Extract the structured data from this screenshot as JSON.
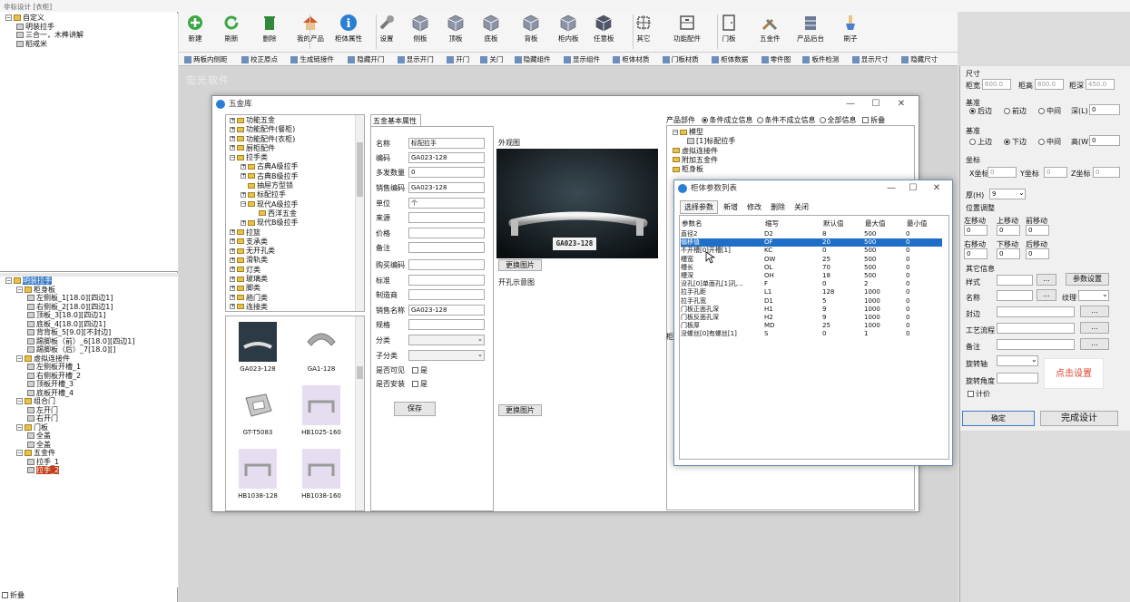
{
  "app_title": "非标设计 [衣柜]",
  "left_tree_top": {
    "nodes": [
      {
        "label": "自定义",
        "level": 0,
        "type": "folder"
      },
      {
        "label": "明装拉手",
        "level": 1,
        "type": "part"
      },
      {
        "label": "三合一，木榫讲解",
        "level": 1,
        "type": "part"
      },
      {
        "label": "稻戒米",
        "level": 1,
        "type": "part"
      }
    ]
  },
  "left_tree_bottom": {
    "nodes": [
      {
        "label": "明装拉手",
        "level": 0,
        "type": "folder",
        "selected": true
      },
      {
        "label": "柜身板",
        "level": 1,
        "type": "folder"
      },
      {
        "label": "左侧板_1[18.0][四边1]",
        "level": 2,
        "type": "part"
      },
      {
        "label": "右侧板_2[18.0][四边1]",
        "level": 2,
        "type": "part"
      },
      {
        "label": "顶板_3[18.0][四边1]",
        "level": 2,
        "type": "part"
      },
      {
        "label": "底板_4[18.0][四边1]",
        "level": 2,
        "type": "part"
      },
      {
        "label": "背背板_5[9.0][不封边]",
        "level": 2,
        "type": "part"
      },
      {
        "label": "踢脚板（前）_6[18.0][四边1]",
        "level": 2,
        "type": "part"
      },
      {
        "label": "踢脚板（后）_7[18.0][]",
        "level": 2,
        "type": "part"
      },
      {
        "label": "虚拟连接件",
        "level": 1,
        "type": "folder"
      },
      {
        "label": "左侧板开槽_1",
        "level": 2,
        "type": "part"
      },
      {
        "label": "右侧板开槽_2",
        "level": 2,
        "type": "part"
      },
      {
        "label": "顶板开槽_3",
        "level": 2,
        "type": "part"
      },
      {
        "label": "底板开槽_4",
        "level": 2,
        "type": "part"
      },
      {
        "label": "组合门",
        "level": 1,
        "type": "folder"
      },
      {
        "label": "左开门",
        "level": 2,
        "type": "part"
      },
      {
        "label": "右开门",
        "level": 2,
        "type": "part"
      },
      {
        "label": "门板",
        "level": 1,
        "type": "folder"
      },
      {
        "label": "全盖",
        "level": 2,
        "type": "part"
      },
      {
        "label": "全盖",
        "level": 2,
        "type": "part"
      },
      {
        "label": "五金件",
        "level": 1,
        "type": "folder"
      },
      {
        "label": "拉手_1",
        "level": 2,
        "type": "part"
      },
      {
        "label": "拉手_2",
        "level": 2,
        "type": "part",
        "highlight": true
      }
    ]
  },
  "left_footer": "折叠",
  "toolbar": {
    "buttons": [
      {
        "label": "新建",
        "icon": "plus-icon",
        "color": "#3aa845"
      },
      {
        "label": "刷新",
        "icon": "refresh-icon",
        "color": "#3aa845"
      },
      {
        "label": "删除",
        "icon": "trash-icon",
        "color": "#2e8a3a"
      },
      {
        "label": "我的产品",
        "icon": "house-icon",
        "color": "#d05a2a"
      },
      {
        "label": "柜体属性",
        "icon": "info-icon",
        "color": "#2a7fd4"
      },
      {
        "label": "设置",
        "icon": "wrench-icon",
        "color": "#777777"
      },
      {
        "label": "侧板",
        "icon": "cube-icon",
        "color": "#8a94a6"
      },
      {
        "label": "顶板",
        "icon": "cube-icon",
        "color": "#8a94a6"
      },
      {
        "label": "底板",
        "icon": "cube-icon",
        "color": "#8a94a6"
      },
      {
        "label": "背板",
        "icon": "cube-icon",
        "color": "#8a94a6"
      },
      {
        "label": "柜内板",
        "icon": "cube-icon",
        "color": "#8a94a6"
      },
      {
        "label": "任意板",
        "icon": "cube-icon",
        "color": "#4d5566"
      },
      {
        "label": "其它",
        "icon": "frame-icon",
        "color": "#555555"
      },
      {
        "label": "功能配件",
        "icon": "drawer-icon",
        "color": "#555555"
      },
      {
        "label": "门板",
        "icon": "door-icon",
        "color": "#555555"
      },
      {
        "label": "五金件",
        "icon": "tools-icon",
        "color": "#8a6a30"
      },
      {
        "label": "产品后台",
        "icon": "server-icon",
        "color": "#6a7a96"
      },
      {
        "label": "刷子",
        "icon": "brush-icon",
        "color": "#4a7fd0"
      }
    ]
  },
  "toolbar2": {
    "items": [
      "两板内侧距",
      "校正原点",
      "生成链接件",
      "隐藏开门",
      "显示开门",
      "开门",
      "关门",
      "隐藏组件",
      "显示组件",
      "柜体材质",
      "门板材质",
      "柜体数据",
      "零件图",
      "板件检测",
      "显示尺寸",
      "隐藏尺寸"
    ]
  },
  "brand_text": "宏光软件",
  "hardware_window": {
    "title": "五金库",
    "categories": [
      {
        "label": "功能五金",
        "level": 0,
        "toggle": "+"
      },
      {
        "label": "功能配件(餐柜)",
        "level": 0,
        "toggle": "+"
      },
      {
        "label": "功能配件(衣柜)",
        "level": 0,
        "toggle": "+"
      },
      {
        "label": "厨柜配件",
        "level": 0,
        "toggle": "+"
      },
      {
        "label": "拉手类",
        "level": 0,
        "toggle": "-"
      },
      {
        "label": "古典A级拉手",
        "level": 1,
        "toggle": "+"
      },
      {
        "label": "古典B级拉手",
        "level": 1,
        "toggle": "+"
      },
      {
        "label": "抽屉方型锁",
        "level": 1,
        "toggle": ""
      },
      {
        "label": "标配拉手",
        "level": 1,
        "toggle": "+"
      },
      {
        "label": "现代A级拉手",
        "level": 1,
        "toggle": "-"
      },
      {
        "label": "西洋五金",
        "level": 2,
        "toggle": ""
      },
      {
        "label": "现代B级拉手",
        "level": 1,
        "toggle": "+"
      },
      {
        "label": "拉篮",
        "level": 0,
        "toggle": "+"
      },
      {
        "label": "支承类",
        "level": 0,
        "toggle": "+"
      },
      {
        "label": "无开孔类",
        "level": 0,
        "toggle": "+"
      },
      {
        "label": "滑轨类",
        "level": 0,
        "toggle": "+"
      },
      {
        "label": "灯类",
        "level": 0,
        "toggle": "+"
      },
      {
        "label": "玻璃类",
        "level": 0,
        "toggle": "+"
      },
      {
        "label": "脚类",
        "level": 0,
        "toggle": "+"
      },
      {
        "label": "趟门类",
        "level": 0,
        "toggle": "+"
      },
      {
        "label": "连接类",
        "level": 0,
        "toggle": "+"
      }
    ],
    "thumbnails": [
      {
        "label": "GA023-128",
        "kind": "handle-dark"
      },
      {
        "label": "GA1-128",
        "kind": "handle-arc"
      },
      {
        "label": "GT-T5083",
        "kind": "handle-box"
      },
      {
        "label": "HB1025-160",
        "kind": "handle-purple"
      },
      {
        "label": "HB1038-128",
        "kind": "handle-purple"
      },
      {
        "label": "HB1038-160",
        "kind": "handle-purple"
      }
    ],
    "section_title": "五金基本属性",
    "form_fields": [
      {
        "label": "名称",
        "value": "标配拉手"
      },
      {
        "label": "编码",
        "value": "GA023-128"
      },
      {
        "label": "多发数量",
        "value": "0"
      },
      {
        "label": "销售编码",
        "value": "GA023-128"
      },
      {
        "label": "单位",
        "value": "个"
      },
      {
        "label": "来源",
        "value": ""
      },
      {
        "label": "价格",
        "value": ""
      },
      {
        "label": "备注",
        "value": ""
      },
      {
        "label": "购买编码",
        "value": ""
      },
      {
        "label": "标准",
        "value": ""
      },
      {
        "label": "制造商",
        "value": ""
      },
      {
        "label": "销售名称",
        "value": "GA023-128"
      },
      {
        "label": "规格",
        "value": ""
      },
      {
        "label": "分类",
        "value": ""
      },
      {
        "label": "子分类",
        "value": ""
      }
    ],
    "visible_label": "是否可见",
    "install_label": "是否安装",
    "yes_label": "是",
    "save_label": "保存",
    "appearance_label": "外观图",
    "image_caption": "GA023-128",
    "change_image_label": "更换图片",
    "hole_label": "开孔示意图",
    "change_image_label2": "更换图片",
    "product_parts_label": "产品部件",
    "filter_options": [
      "条件成立信息",
      "条件不成立信息",
      "全部信息"
    ],
    "filter_selected": 0,
    "collapse_label": "拆叠",
    "product_tree": [
      {
        "label": "模型",
        "level": 0
      },
      {
        "label": "[1]标配拉手",
        "level": 1
      },
      {
        "label": "虚拟连接件",
        "level": 0
      },
      {
        "label": "附加五金件",
        "level": 0
      },
      {
        "label": "柜身板",
        "level": 0
      }
    ],
    "side_tab_label": "柜"
  },
  "params_window": {
    "title": "柜体参数列表",
    "menu": [
      "选择参数",
      "新增",
      "修改",
      "删除",
      "关闭"
    ],
    "columns": [
      "参数名",
      "缩写",
      "默认值",
      "最大值",
      "最小值"
    ],
    "rows": [
      [
        "直径2",
        "D2",
        "8",
        "500",
        "0"
      ],
      [
        "偏移值",
        "OF",
        "20",
        "500",
        "0"
      ],
      [
        "不开槽[0]开槽[1]",
        "KC",
        "0",
        "500",
        "0"
      ],
      [
        "槽宽",
        "OW",
        "25",
        "500",
        "0"
      ],
      [
        "槽长",
        "OL",
        "70",
        "500",
        "0"
      ],
      [
        "槽深",
        "OH",
        "18",
        "500",
        "0"
      ],
      [
        "没孔[0]单面孔[1]孔…",
        "F",
        "0",
        "2",
        "0"
      ],
      [
        "拉手孔距",
        "L1",
        "128",
        "1000",
        "0"
      ],
      [
        "拉手孔宽",
        "D1",
        "5",
        "1000",
        "0"
      ],
      [
        "门板正面孔深",
        "H1",
        "9",
        "1000",
        "0"
      ],
      [
        "门板反面孔深",
        "H2",
        "9",
        "1000",
        "0"
      ],
      [
        "门板厚",
        "MD",
        "25",
        "1000",
        "0"
      ],
      [
        "没螺丝[0]有螺丝[1]",
        "S",
        "0",
        "1",
        "0"
      ]
    ],
    "selected_row": 1
  },
  "right_panel": {
    "size_label": "尺寸",
    "width_label": "柜宽",
    "width_value": "600.0",
    "height_label": "柜高",
    "height_value": "800.0",
    "depth_label": "柜深",
    "depth_value": "450.0",
    "basis1_label": "基准",
    "basis1_options": [
      "后边",
      "前边",
      "中间"
    ],
    "basis1_selected": 0,
    "depth_field_label": "深(L)",
    "depth_field_value": "0",
    "basis2_label": "基准",
    "basis2_options": [
      "上边",
      "下边",
      "中间"
    ],
    "basis2_selected": 1,
    "height_field_label": "高(W)",
    "height_field_value": "0",
    "coord_label": "坐标",
    "x_label": "X坐标",
    "x_value": "0",
    "y_label": "Y坐标",
    "y_value": "0",
    "z_label": "Z坐标",
    "z_value": "0",
    "thick_label": "厚(H)",
    "thick_value": "9",
    "pos_label": "位置调整",
    "moves": [
      {
        "label": "左移动",
        "value": "0"
      },
      {
        "label": "上移动",
        "value": "0"
      },
      {
        "label": "前移动",
        "value": "0"
      },
      {
        "label": "右移动",
        "value": "0"
      },
      {
        "label": "下移动",
        "value": "0"
      },
      {
        "label": "后移动",
        "value": "0"
      }
    ],
    "other_label": "其它信息",
    "style_label": "样式",
    "param_setting_label": "参数设置",
    "name_label": "名称",
    "texture_label": "纹理",
    "edge_label": "封边",
    "process_label": "工艺流程",
    "remark_label": "备注",
    "rot_axis_label": "旋转轴",
    "rot_angle_label": "旋转角度",
    "promo_text": "点击设置",
    "price_label": "计价",
    "ok_label": "确定",
    "finish_label": "完成设计"
  }
}
